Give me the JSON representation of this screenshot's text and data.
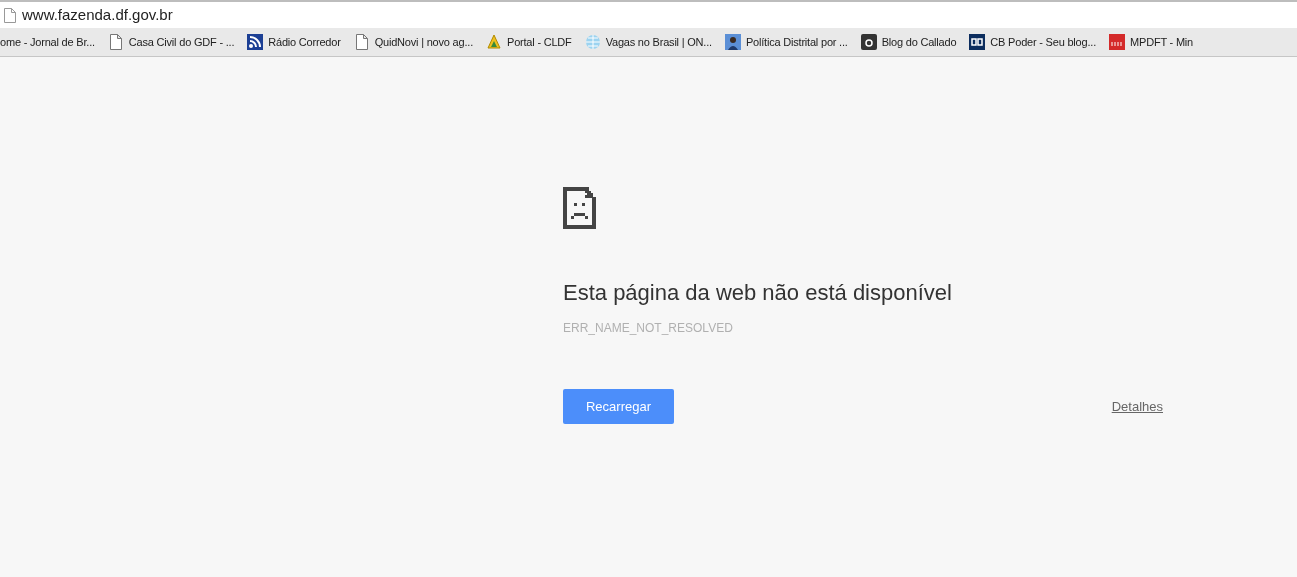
{
  "address_bar": {
    "url": "www.fazenda.df.gov.br"
  },
  "bookmarks": [
    {
      "label": "ome - Jornal de Br...",
      "kind": "none"
    },
    {
      "label": "Casa Civil do GDF - ...",
      "kind": "page"
    },
    {
      "label": "Rádio Corredor",
      "kind": "rss"
    },
    {
      "label": "QuidNovi | novo ag...",
      "kind": "page"
    },
    {
      "label": "Portal - CLDF",
      "kind": "emblem"
    },
    {
      "label": "Vagas no Brasil | ON...",
      "kind": "globe"
    },
    {
      "label": "Política Distrital por ...",
      "kind": "photo"
    },
    {
      "label": "Blog do Callado",
      "kind": "letter"
    },
    {
      "label": "CB Poder - Seu blog...",
      "kind": "cb"
    },
    {
      "label": "MPDFT - Min",
      "kind": "mp"
    }
  ],
  "error_page": {
    "title": "Esta página da web não está disponível",
    "code": "ERR_NAME_NOT_RESOLVED",
    "reload_button": "Recarregar",
    "details_link": "Detalhes"
  }
}
